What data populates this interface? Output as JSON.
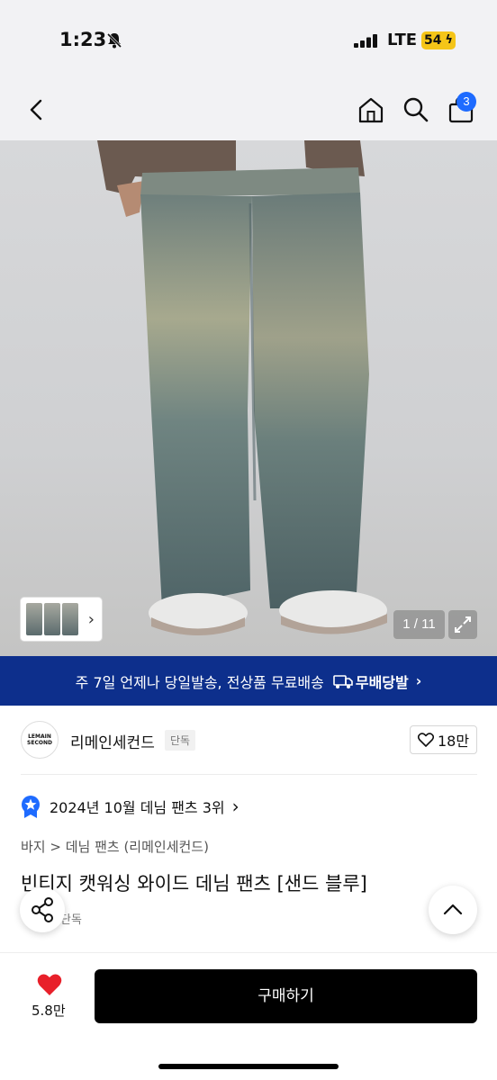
{
  "status_bar": {
    "time": "1:23",
    "network": "LTE",
    "battery": "54"
  },
  "nav": {
    "cart_count": "3"
  },
  "gallery": {
    "counter": "1 / 11"
  },
  "delivery_banner": {
    "text": "주 7일 언제나 당일발송, 전상품 무료배송",
    "badge": "무배당발",
    "chevron": "›"
  },
  "brand": {
    "logo_text": "LEMAIN SECOND",
    "name": "리메인세컨드",
    "tag": "단독",
    "likes": "18만"
  },
  "ranking": {
    "text": "2024년 10월 데님 팬츠 3위",
    "chevron": "›"
  },
  "breadcrumb": "바지 > 데님 팬츠 (리메인세컨드)",
  "product": {
    "title": "빈티지 캣워싱 와이드 데님 팬츠 [샌드 블루]",
    "sub_tag": "단독"
  },
  "bottom_bar": {
    "wish_count": "5.8만",
    "buy_label": "구매하기"
  },
  "colors": {
    "banner_bg": "#0d2f8c",
    "badge_blue": "#1e6bff",
    "heart_red": "#e8202a",
    "battery_yellow": "#f5c518"
  }
}
